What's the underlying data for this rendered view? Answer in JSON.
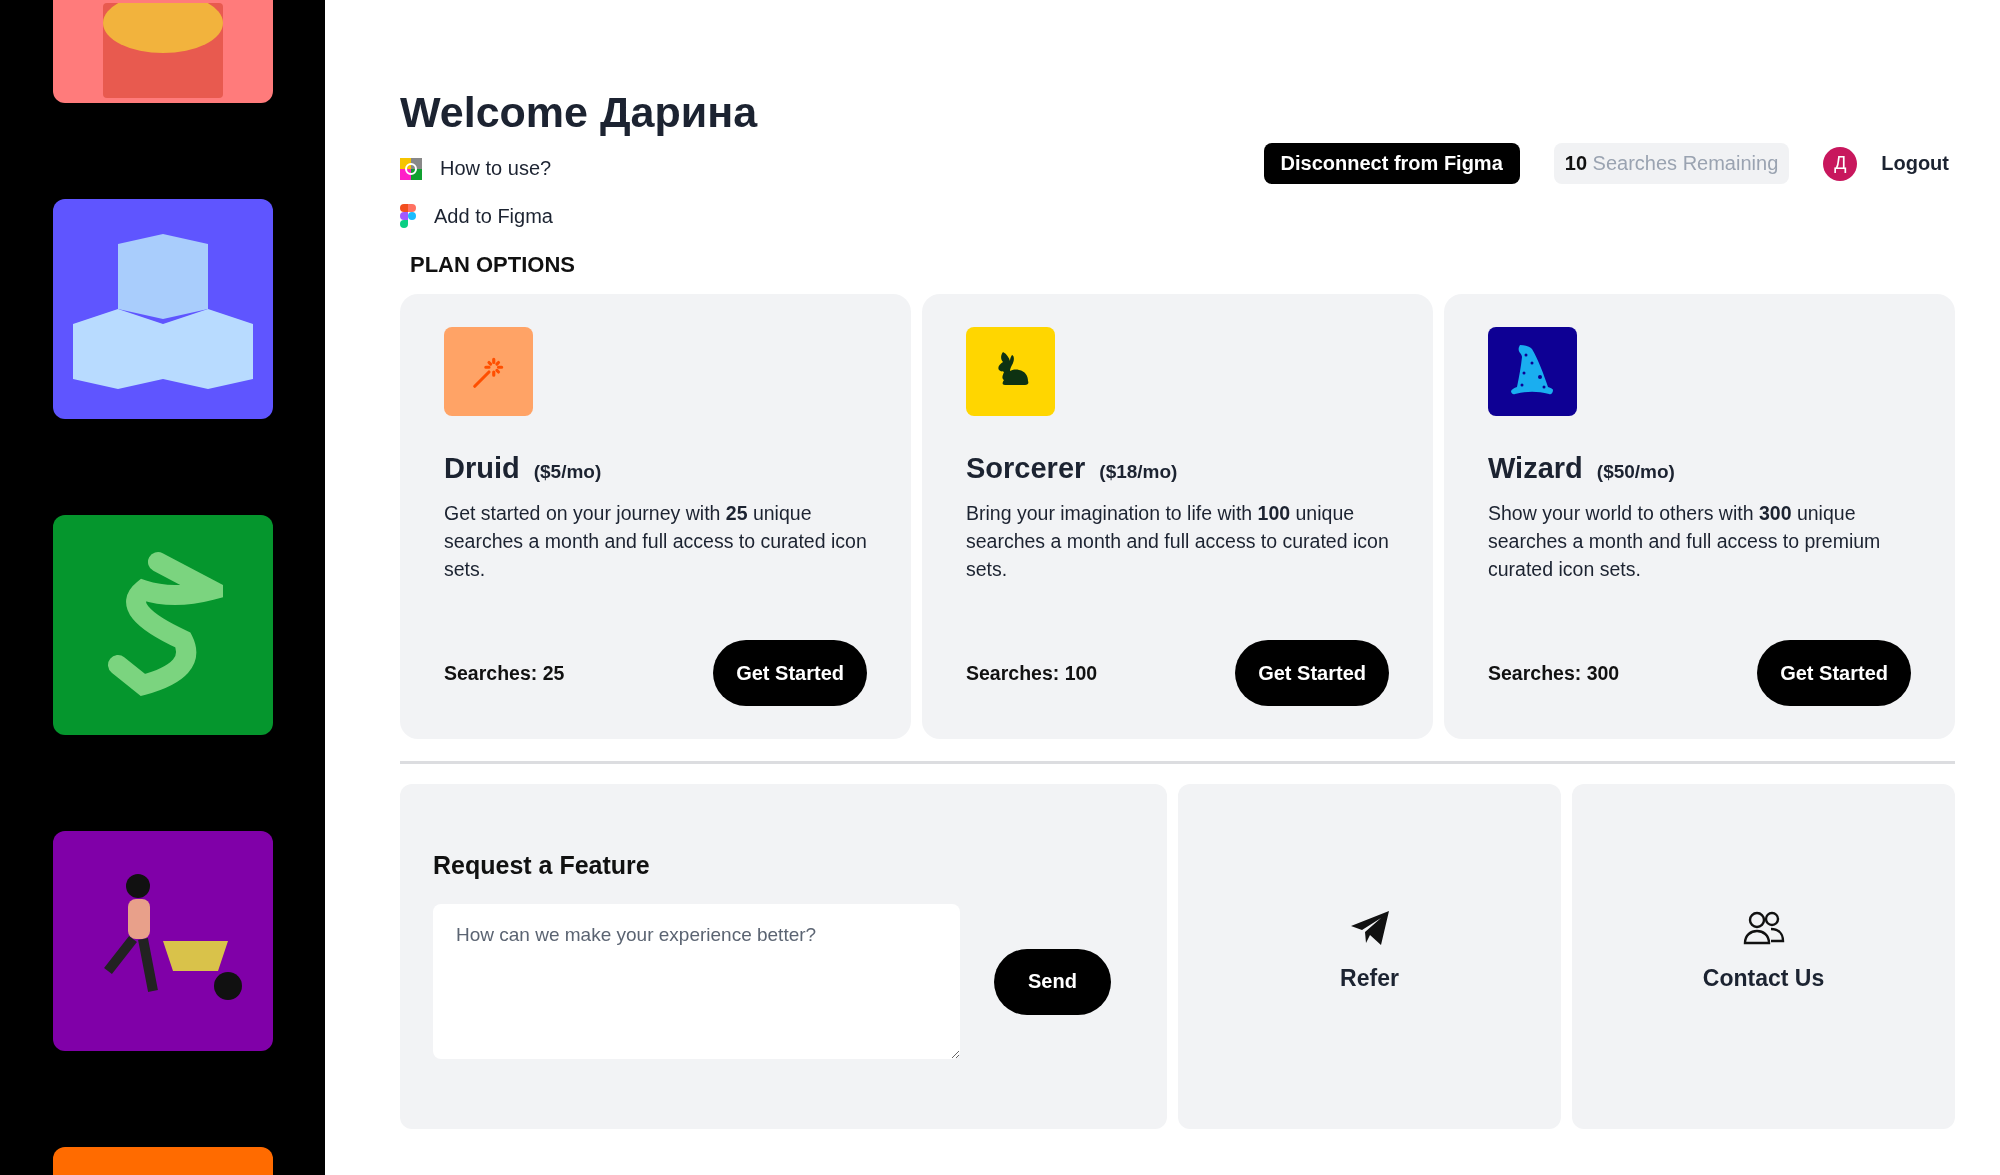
{
  "sidebar": {
    "tiles": [
      {
        "kind": "face",
        "color": "#ff7b7b"
      },
      {
        "kind": "cubes",
        "color": "#5f55ff"
      },
      {
        "kind": "squiggle",
        "color": "#05962d"
      },
      {
        "kind": "figure",
        "color": "#8000a8"
      },
      {
        "kind": "plain",
        "color": "#ff6b00"
      }
    ]
  },
  "header": {
    "title": "Welcome Дарина",
    "links": [
      {
        "kind": "guide",
        "label": "How to use?"
      },
      {
        "kind": "figma",
        "label": "Add to Figma"
      }
    ],
    "disconnect_button": "Disconnect from Figma",
    "searches": {
      "count": "10",
      "label": "Searches Remaining"
    },
    "avatar_initial": "Д",
    "logout": "Logout"
  },
  "plans": {
    "heading": "PLAN OPTIONS",
    "items": [
      {
        "kind": "wand",
        "color": "#ffa366",
        "name": "Druid",
        "price": "($5/mo)",
        "description": "Get started on your journey with **25** unique searches a month and full access to curated icon sets.",
        "searches": "Searches: 25",
        "button": "Get Started"
      },
      {
        "kind": "rabbit",
        "color": "#ffd600",
        "name": "Sorcerer",
        "price": "($18/mo)",
        "description": "Bring your imagination to life with **100** unique searches a month and full access to curated icon sets.",
        "searches": "Searches: 100",
        "button": "Get Started"
      },
      {
        "kind": "hat",
        "color": "#0e0094",
        "name": "Wizard",
        "price": "($50/mo)",
        "description": "Show your world to others with **300** unique searches a month and full access to premium curated icon sets.",
        "searches": "Searches: 300",
        "button": "Get Started"
      }
    ]
  },
  "feature_request": {
    "title": "Request a Feature",
    "placeholder": "How can we make your experience better?",
    "button": "Send"
  },
  "actions": [
    {
      "kind": "refer",
      "label": "Refer"
    },
    {
      "kind": "contact",
      "label": "Contact Us"
    }
  ]
}
